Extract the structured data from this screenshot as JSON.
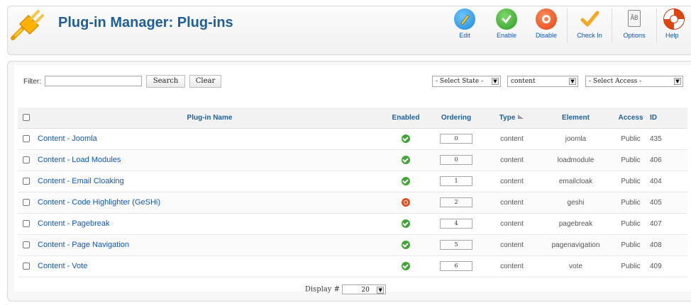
{
  "header": {
    "title": "Plug-in Manager: Plug-ins",
    "toolbar": [
      {
        "label": "Edit",
        "icon": "edit-icon"
      },
      {
        "label": "Enable",
        "icon": "enable-icon"
      },
      {
        "label": "Disable",
        "icon": "disable-icon"
      },
      {
        "label": "Check In",
        "icon": "check-in-icon"
      },
      {
        "label": "Options",
        "icon": "options-icon"
      },
      {
        "label": "Help",
        "icon": "help-icon"
      }
    ]
  },
  "filter": {
    "label": "Filter:",
    "value": "",
    "search_label": "Search",
    "clear_label": "Clear",
    "state_select": "- Select State -",
    "type_select": "content",
    "access_select": "- Select Access -"
  },
  "table": {
    "columns": [
      "Plug-in Name",
      "Enabled",
      "Ordering",
      "Type",
      "Element",
      "Access",
      "ID"
    ],
    "rows": [
      {
        "name": "Content - Joomla",
        "enabled": true,
        "ordering": "0",
        "type": "content",
        "element": "joomla",
        "access": "Public",
        "id": "435"
      },
      {
        "name": "Content - Load Modules",
        "enabled": true,
        "ordering": "0",
        "type": "content",
        "element": "loadmodule",
        "access": "Public",
        "id": "406"
      },
      {
        "name": "Content - Email Cloaking",
        "enabled": true,
        "ordering": "1",
        "type": "content",
        "element": "emailcloak",
        "access": "Public",
        "id": "404"
      },
      {
        "name": "Content - Code Highlighter (GeSHi)",
        "enabled": false,
        "ordering": "2",
        "type": "content",
        "element": "geshi",
        "access": "Public",
        "id": "405"
      },
      {
        "name": "Content - Pagebreak",
        "enabled": true,
        "ordering": "4",
        "type": "content",
        "element": "pagebreak",
        "access": "Public",
        "id": "407"
      },
      {
        "name": "Content - Page Navigation",
        "enabled": true,
        "ordering": "5",
        "type": "content",
        "element": "pagenavigation",
        "access": "Public",
        "id": "408"
      },
      {
        "name": "Content - Vote",
        "enabled": true,
        "ordering": "6",
        "type": "content",
        "element": "vote",
        "access": "Public",
        "id": "409"
      }
    ]
  },
  "footer": {
    "display_label": "Display #",
    "display_value": "20"
  },
  "colors": {
    "title": "#1e5f9a",
    "link": "#0b55c4",
    "enabled": "#3fa535",
    "disabled": "#e44b1a"
  }
}
